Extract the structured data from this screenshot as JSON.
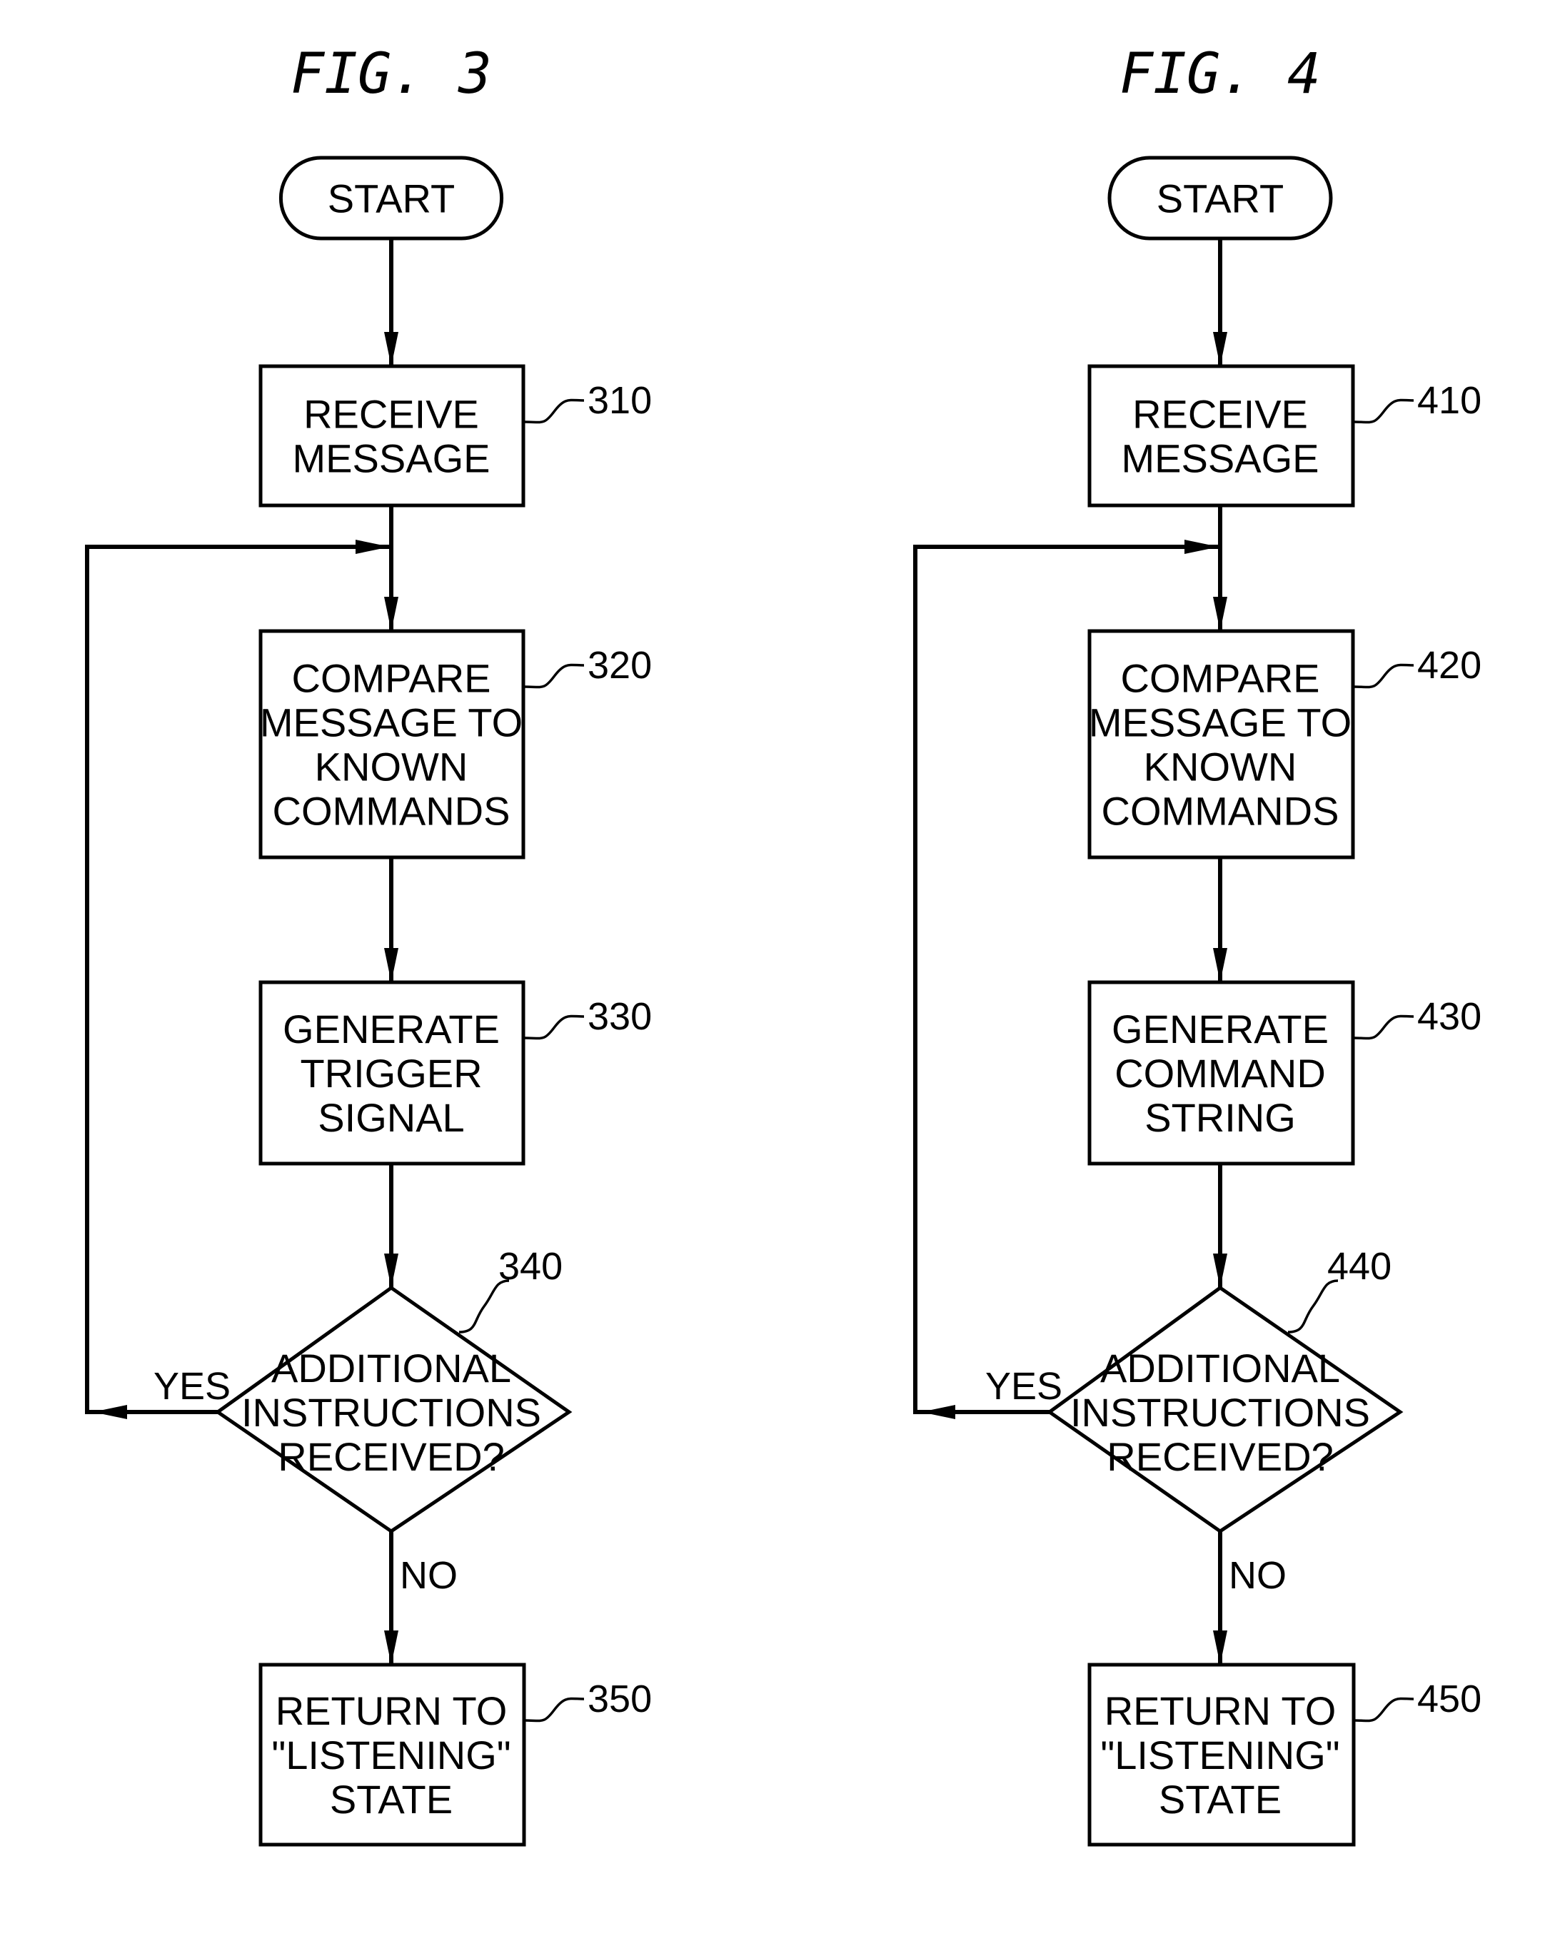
{
  "figures": [
    {
      "title": "FIG. 3",
      "start": "START",
      "steps": [
        {
          "ref": "310",
          "lines": [
            "RECEIVE",
            "MESSAGE"
          ]
        },
        {
          "ref": "320",
          "lines": [
            "COMPARE",
            "MESSAGE TO",
            "KNOWN",
            "COMMANDS"
          ]
        },
        {
          "ref": "330",
          "lines": [
            "GENERATE",
            "TRIGGER",
            "SIGNAL"
          ]
        }
      ],
      "decision": {
        "ref": "340",
        "lines": [
          "ADDITIONAL",
          "INSTRUCTIONS",
          "RECEIVED?"
        ],
        "yes_label": "YES",
        "no_label": "NO"
      },
      "end": {
        "ref": "350",
        "lines": [
          "RETURN TO",
          "\"LISTENING\"",
          "STATE"
        ]
      }
    },
    {
      "title": "FIG. 4",
      "start": "START",
      "steps": [
        {
          "ref": "410",
          "lines": [
            "RECEIVE",
            "MESSAGE"
          ]
        },
        {
          "ref": "420",
          "lines": [
            "COMPARE",
            "MESSAGE TO",
            "KNOWN",
            "COMMANDS"
          ]
        },
        {
          "ref": "430",
          "lines": [
            "GENERATE",
            "COMMAND",
            "STRING"
          ]
        }
      ],
      "decision": {
        "ref": "440",
        "lines": [
          "ADDITIONAL",
          "INSTRUCTIONS",
          "RECEIVED?"
        ],
        "yes_label": "YES",
        "no_label": "NO"
      },
      "end": {
        "ref": "450",
        "lines": [
          "RETURN TO",
          "\"LISTENING\"",
          "STATE"
        ]
      }
    }
  ]
}
